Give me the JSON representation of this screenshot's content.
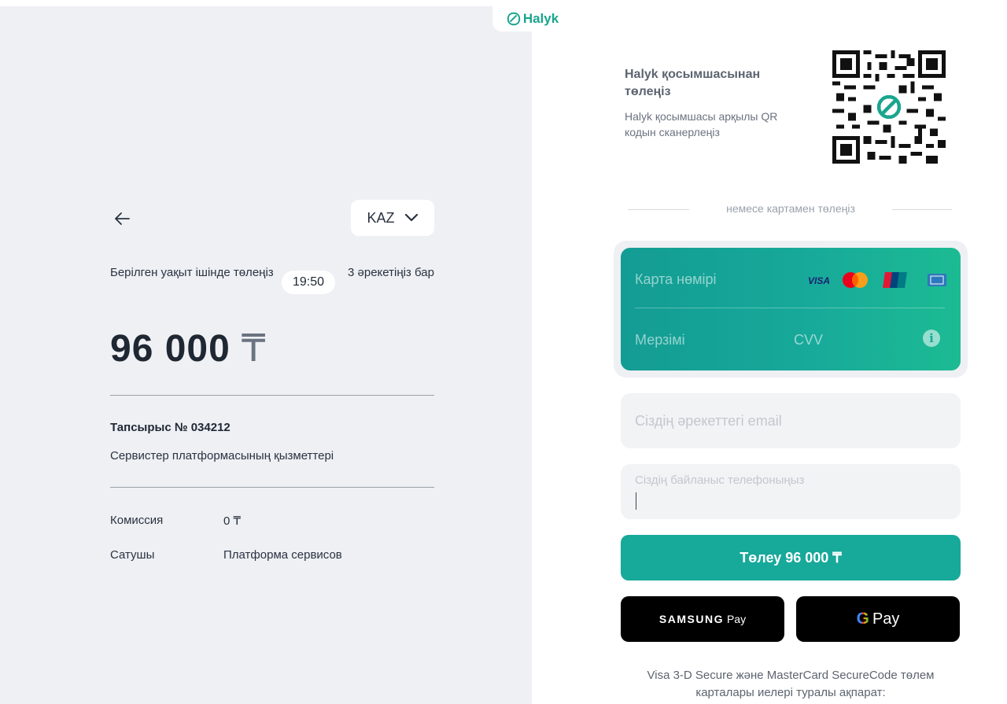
{
  "brand": {
    "logo_text": "Halyk"
  },
  "left": {
    "language": "KAZ",
    "timer": {
      "text": "Берілген уақыт ішінде төлеңіз",
      "time": "19:50",
      "attempts": "3 әрекетіңіз бар"
    },
    "amount": "96 000",
    "currency": "₸",
    "order": {
      "title": "Тапсырыс № 034212",
      "description": "Сервистер платформасының қызметтері"
    },
    "commission": {
      "label": "Комиссия",
      "value": "0 ₸"
    },
    "seller": {
      "label": "Сатушы",
      "value": "Платформа сервисов"
    }
  },
  "right": {
    "qr": {
      "title": "Halyk қосымшасынан төлеңіз",
      "description": "Halyk қосымшасы арқылы QR кодын сканерлеңіз"
    },
    "or_text": "немесе картамен төлеңіз",
    "card": {
      "number_placeholder": "Карта нөмірі",
      "expiry_placeholder": "Мерзімі",
      "cvv_placeholder": "CVV",
      "brands": [
        "VISA",
        "Mastercard",
        "UnionPay",
        "AMEX"
      ]
    },
    "email_placeholder": "Сіздің әрекеттегі email",
    "phone_label": "Сіздің байланыс телефоныңыз",
    "pay_button": "Төлеу 96 000 ₸",
    "samsung_pay": {
      "brand": "SAMSUNG",
      "pay": "Pay"
    },
    "google_pay": {
      "g": "G",
      "pay": "Pay"
    },
    "footer": "Visa 3-D Secure және MasterCard SecureCode төлем карталары иелері туралы ақпарат:"
  },
  "colors": {
    "accent": "#17a99a",
    "left_bg": "#eef0f4",
    "card_gradient_start": "#139c93",
    "card_gradient_end": "#1cbb93"
  }
}
